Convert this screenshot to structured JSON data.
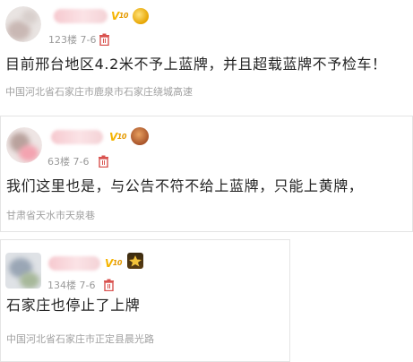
{
  "colors": {
    "vip": "#f5b400",
    "trash": "#d9534f",
    "meta": "#9a9a9a",
    "text": "#222222"
  },
  "comments": [
    {
      "meta": "123楼 7-6",
      "vip_label": "V",
      "vip_level": "10",
      "text": "目前邢台地区4.2米不予上蓝牌，并且超载蓝牌不予检车！",
      "location": "中国河北省石家庄市鹿泉市石家庄绕城高速"
    },
    {
      "meta": "63楼 7-6",
      "vip_label": "V",
      "vip_level": "10",
      "text": "我们这里也是，与公告不符不给上蓝牌，只能上黄牌，",
      "location": "甘肃省天水市天泉巷"
    },
    {
      "meta": "134楼 7-6",
      "vip_label": "V",
      "vip_level": "10",
      "text": "石家庄也停止了上牌",
      "location": "中国河北省石家庄市正定县晨光路"
    }
  ],
  "icons": {
    "delete": "trash-icon",
    "vip": "vip-badge-icon",
    "medal": "medal-icon"
  }
}
